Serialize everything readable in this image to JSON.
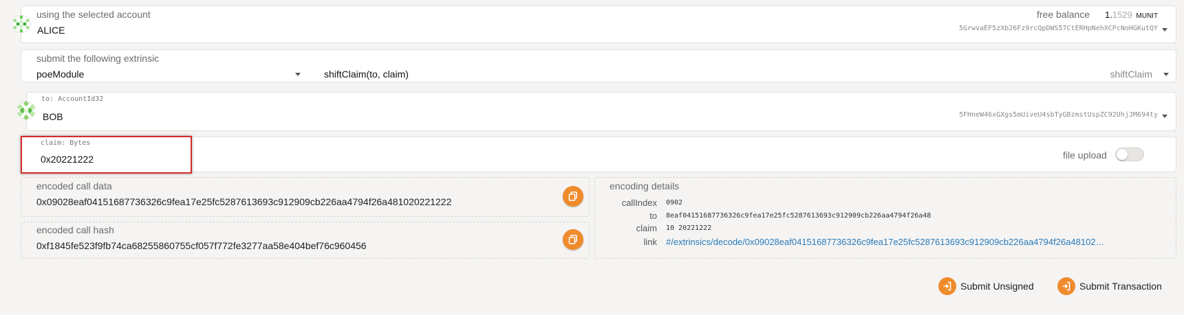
{
  "account": {
    "label": "using the selected account",
    "name": "ALICE",
    "balance_label": "free balance",
    "balance_int": "1.",
    "balance_frac": "1529",
    "balance_unit": "MUNIT",
    "address": "5GrwvaEF5zXb26Fz9rcQpDWS57CtERHpNehXCPcNoHGKutQY"
  },
  "extrinsic": {
    "label": "submit the following extrinsic",
    "module": "poeModule",
    "call": "shiftClaim(to, claim)",
    "method": "shiftClaim"
  },
  "to_param": {
    "label": "to: AccountId32",
    "name": "BOB",
    "address": "5FHneW46xGXgs5mUiveU4sbTyGBzmstUspZC92UhjJM694ty"
  },
  "claim_param": {
    "label": "claim: Bytes",
    "value": "0x20221222",
    "file_upload_label": "file upload",
    "file_upload_on": false
  },
  "encoded_call_data": {
    "label": "encoded call data",
    "value": "0x09028eaf04151687736326c9fea17e25fc5287613693c912909cb226aa4794f26a481020221222"
  },
  "encoded_call_hash": {
    "label": "encoded call hash",
    "value": "0xf1845fe523f9fb74ca68255860755cf057f772fe3277aa58e404bef76c960456"
  },
  "encoding_details": {
    "label": "encoding details",
    "callIndex_key": "callIndex",
    "callIndex_val": "0902",
    "to_key": "to",
    "to_val": "8eaf04151687736326c9fea17e25fc5287613693c912909cb226aa4794f26a48",
    "claim_key": "claim",
    "claim_val": "10 20221222",
    "link_key": "link",
    "link_val": "#/extrinsics/decode/0x09028eaf04151687736326c9fea17e25fc5287613693c912909cb226aa4794f26a48102…"
  },
  "actions": {
    "submit_unsigned": "Submit Unsigned",
    "submit_transaction": "Submit Transaction"
  },
  "icons": {
    "copy": "copy-icon",
    "sign_in": "sign-in-icon",
    "accent": "#ef8b2c",
    "highlight": "#d42a2a"
  }
}
